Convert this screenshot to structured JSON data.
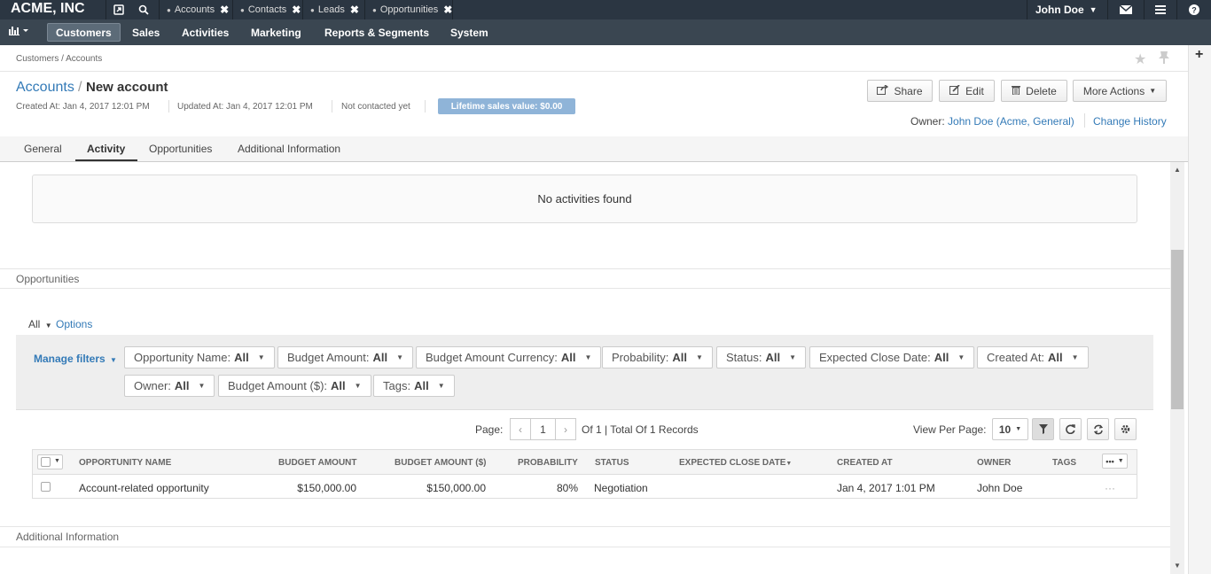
{
  "topbar": {
    "brand": "ACME, INC",
    "pinned_tabs": [
      {
        "label": "Accounts"
      },
      {
        "label": "Contacts"
      },
      {
        "label": "Leads"
      },
      {
        "label": "Opportunities"
      }
    ],
    "user": "John Doe"
  },
  "menu": {
    "items": [
      "Customers",
      "Sales",
      "Activities",
      "Marketing",
      "Reports & Segments",
      "System"
    ],
    "active": "Customers"
  },
  "breadcrumb": "Customers / Accounts",
  "header": {
    "parent_link": "Accounts",
    "separator": "/",
    "title": "New account",
    "created": "Created At: Jan 4, 2017 12:01 PM",
    "updated": "Updated At: Jan 4, 2017 12:01 PM",
    "contacted": "Not contacted yet",
    "lifetime_badge": "Lifetime sales value: $0.00"
  },
  "actions": {
    "share": "Share",
    "edit": "Edit",
    "delete": "Delete",
    "more": "More Actions"
  },
  "owner": {
    "label": "Owner:",
    "name": "John Doe",
    "org": "(Acme, General)",
    "change_history": "Change History"
  },
  "tabs": [
    "General",
    "Activity",
    "Opportunities",
    "Additional Information"
  ],
  "activity": {
    "empty_message": "No activities found"
  },
  "sections": {
    "opportunities": "Opportunities",
    "additional": "Additional Information"
  },
  "filters": {
    "all_label": "All",
    "options_label": "Options",
    "manage_label": "Manage filters",
    "items": [
      {
        "name": "Opportunity Name:",
        "value": "All"
      },
      {
        "name": "Budget Amount:",
        "value": "All"
      },
      {
        "name": "Budget Amount Currency:",
        "value": "All"
      },
      {
        "name": "Probability:",
        "value": "All"
      },
      {
        "name": "Status:",
        "value": "All"
      },
      {
        "name": "Expected Close Date:",
        "value": "All"
      },
      {
        "name": "Created At:",
        "value": "All"
      },
      {
        "name": "Owner:",
        "value": "All"
      },
      {
        "name": "Budget Amount ($):",
        "value": "All"
      },
      {
        "name": "Tags:",
        "value": "All"
      }
    ]
  },
  "pager": {
    "page_label": "Page:",
    "page_value": "1",
    "summary": "Of 1 | Total Of 1 Records",
    "view_per_page_label": "View Per Page:",
    "view_per_page_value": "10"
  },
  "grid": {
    "columns": [
      "Opportunity Name",
      "Budget Amount",
      "Budget Amount ($)",
      "Probability",
      "Status",
      "Expected Close Date",
      "Created At",
      "Owner",
      "Tags"
    ],
    "rows": [
      {
        "name": "Account-related opportunity",
        "budget": "$150,000.00",
        "budget_usd": "$150,000.00",
        "probability": "80%",
        "status": "Negotiation",
        "close_date": "",
        "created": "Jan 4, 2017 1:01 PM",
        "owner": "John Doe",
        "tags": "",
        "actions": "···"
      }
    ]
  }
}
